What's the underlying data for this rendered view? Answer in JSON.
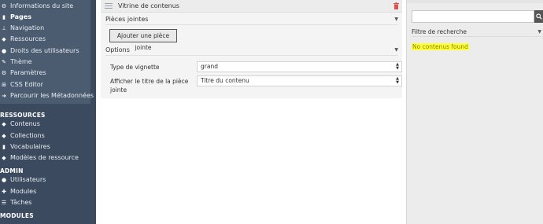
{
  "sidebar": {
    "site_items": [
      {
        "label": "Informations du site",
        "icon": "cogs-icon"
      },
      {
        "label": "Pages",
        "icon": "page-icon"
      },
      {
        "label": "Navigation",
        "icon": "sitemap-icon"
      },
      {
        "label": "Ressources",
        "icon": "cubes-icon"
      },
      {
        "label": "Droits des utilisateurs",
        "icon": "users-icon"
      },
      {
        "label": "Thème",
        "icon": "brush-icon"
      },
      {
        "label": "Paramètres",
        "icon": "cogs-icon"
      },
      {
        "label": "CSS Editor",
        "icon": "plus-box-icon"
      },
      {
        "label": "Parcourir les Métadonnées",
        "icon": "arrow-circle-icon"
      }
    ],
    "sections": {
      "ressources": "RESSOURCES",
      "admin": "ADMIN",
      "modules": "MODULES"
    },
    "ressources_items": [
      {
        "label": "Contenus",
        "icon": "cube-icon"
      },
      {
        "label": "Collections",
        "icon": "collection-icon"
      },
      {
        "label": "Vocabulaires",
        "icon": "book-icon"
      },
      {
        "label": "Modèles de ressource",
        "icon": "cubes-icon"
      }
    ],
    "admin_items": [
      {
        "label": "Utilisateurs",
        "icon": "user-icon"
      },
      {
        "label": "Modules",
        "icon": "puzzle-icon"
      },
      {
        "label": "Tâches",
        "icon": "tasks-icon"
      }
    ]
  },
  "block": {
    "title": "Vitrine de contenus",
    "attachments_title": "Pièces jointes",
    "add_button": "Ajouter une pièce jointe",
    "options_title": "Options",
    "thumbnail_label": "Type de vignette",
    "thumbnail_value": "grand",
    "show_title_label": "Afficher le titre de la pièce jointe",
    "show_title_value": "Titre du contenu"
  },
  "right_panel": {
    "filter_label": "Filtre de recherche",
    "empty_message": "No contenus found"
  },
  "colors": {
    "sidebar": "#3b4a5e",
    "sidebar_site_box": "#4b5b70",
    "highlight": "#ffff3d",
    "trash": "#d9534f"
  }
}
